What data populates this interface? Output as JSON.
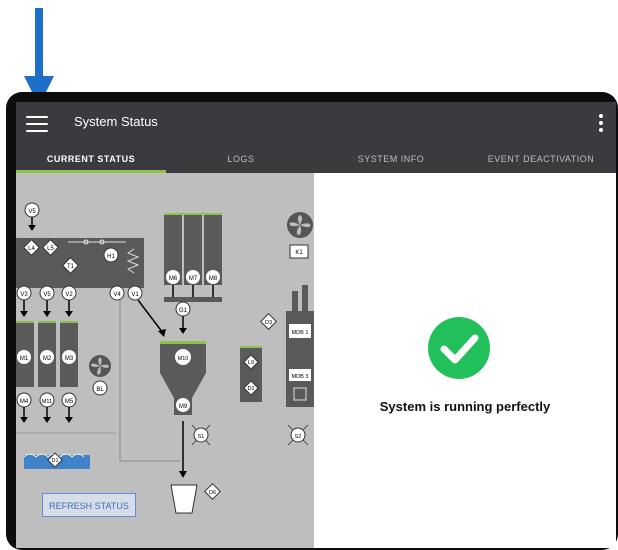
{
  "app": {
    "title": "System Status"
  },
  "tabs": [
    {
      "label": "CURRENT STATUS",
      "active": true
    },
    {
      "label": "LOGS",
      "active": false
    },
    {
      "label": "SYSTEM INFO",
      "active": false
    },
    {
      "label": "EVENT DEACTIVATION",
      "active": false
    }
  ],
  "status": {
    "message": "System is running perfectly",
    "state": "ok"
  },
  "actions": {
    "refresh_label": "REFRESH STATUS"
  },
  "diagram": {
    "valves": {
      "v5_top": "V5",
      "v3": "V3",
      "v5": "V5",
      "v2": "V2",
      "v4": "V4",
      "v1": "V1"
    },
    "hopper_labels": {
      "m1": "M1",
      "m2": "M2",
      "m3": "M3",
      "m4": "M4",
      "m11": "M11",
      "m5": "M5",
      "m6": "M6",
      "m7": "M7",
      "m8": "M8",
      "m10": "M10",
      "m9": "M9",
      "h1": "H1",
      "g1": "G1",
      "bl": "BL"
    },
    "sensors": {
      "l4": "L4",
      "l5": "L5",
      "t1": "T1",
      "d1": "D1",
      "d2": "D2",
      "d3": "D3",
      "d6": "D6",
      "l9": "L9",
      "s1": "S1",
      "s2": "S2"
    },
    "units": {
      "k1": "K1",
      "mdb1": "MDB 1",
      "mdb3": "MDB 3"
    }
  },
  "colors": {
    "appbar": "#3b3a3f",
    "tab_indicator": "#8bc34a",
    "ok_green": "#22c05a",
    "arrow_blue": "#1e6fc8"
  },
  "icons": {
    "menu": "hamburger-icon",
    "more": "more-vertical-icon",
    "ok": "check-circle-icon",
    "fan": "fan-icon"
  }
}
